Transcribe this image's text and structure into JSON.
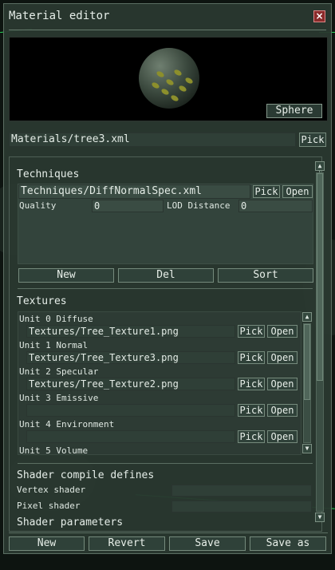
{
  "window": {
    "title": "Material editor"
  },
  "preview": {
    "shape_label": "Sphere"
  },
  "material": {
    "path": "Materials/tree3.xml",
    "pick_label": "Pick"
  },
  "techniques": {
    "heading": "Techniques",
    "item": {
      "path": "Techniques/DiffNormalSpec.xml",
      "pick_label": "Pick",
      "open_label": "Open",
      "quality_label": "Quality",
      "quality_value": "0",
      "lod_label": "LOD Distance",
      "lod_value": "0"
    },
    "new_label": "New",
    "del_label": "Del",
    "sort_label": "Sort"
  },
  "textures": {
    "heading": "Textures",
    "units": [
      {
        "label": "Unit 0 Diffuse",
        "file": "Textures/Tree_Texture1.png",
        "pick": "Pick",
        "open": "Open"
      },
      {
        "label": "Unit 1 Normal",
        "file": "Textures/Tree_Texture3.png",
        "pick": "Pick",
        "open": "Open"
      },
      {
        "label": "Unit 2 Specular",
        "file": "Textures/Tree_Texture2.png",
        "pick": "Pick",
        "open": "Open"
      },
      {
        "label": "Unit 3 Emissive",
        "file": "",
        "pick": "Pick",
        "open": "Open"
      },
      {
        "label": "Unit 4 Environment",
        "file": "",
        "pick": "Pick",
        "open": "Open"
      },
      {
        "label": "Unit 5 Volume"
      }
    ]
  },
  "shader": {
    "heading": "Shader compile defines",
    "vertex_label": "Vertex shader",
    "vertex_value": "",
    "pixel_label": "Pixel shader",
    "pixel_value": "",
    "params_heading": "Shader parameters"
  },
  "footer": {
    "new_label": "New",
    "revert_label": "Revert",
    "save_label": "Save",
    "saveas_label": "Save as"
  },
  "icons": {
    "close": "close-icon",
    "scroll_up": "arrow-up-icon",
    "scroll_down": "arrow-down-icon"
  },
  "colors": {
    "panel_bg": "#2a3830",
    "field_bg": "#2f3f37",
    "close_red": "#8a2a2a",
    "accent_green": "#2bd45a"
  }
}
